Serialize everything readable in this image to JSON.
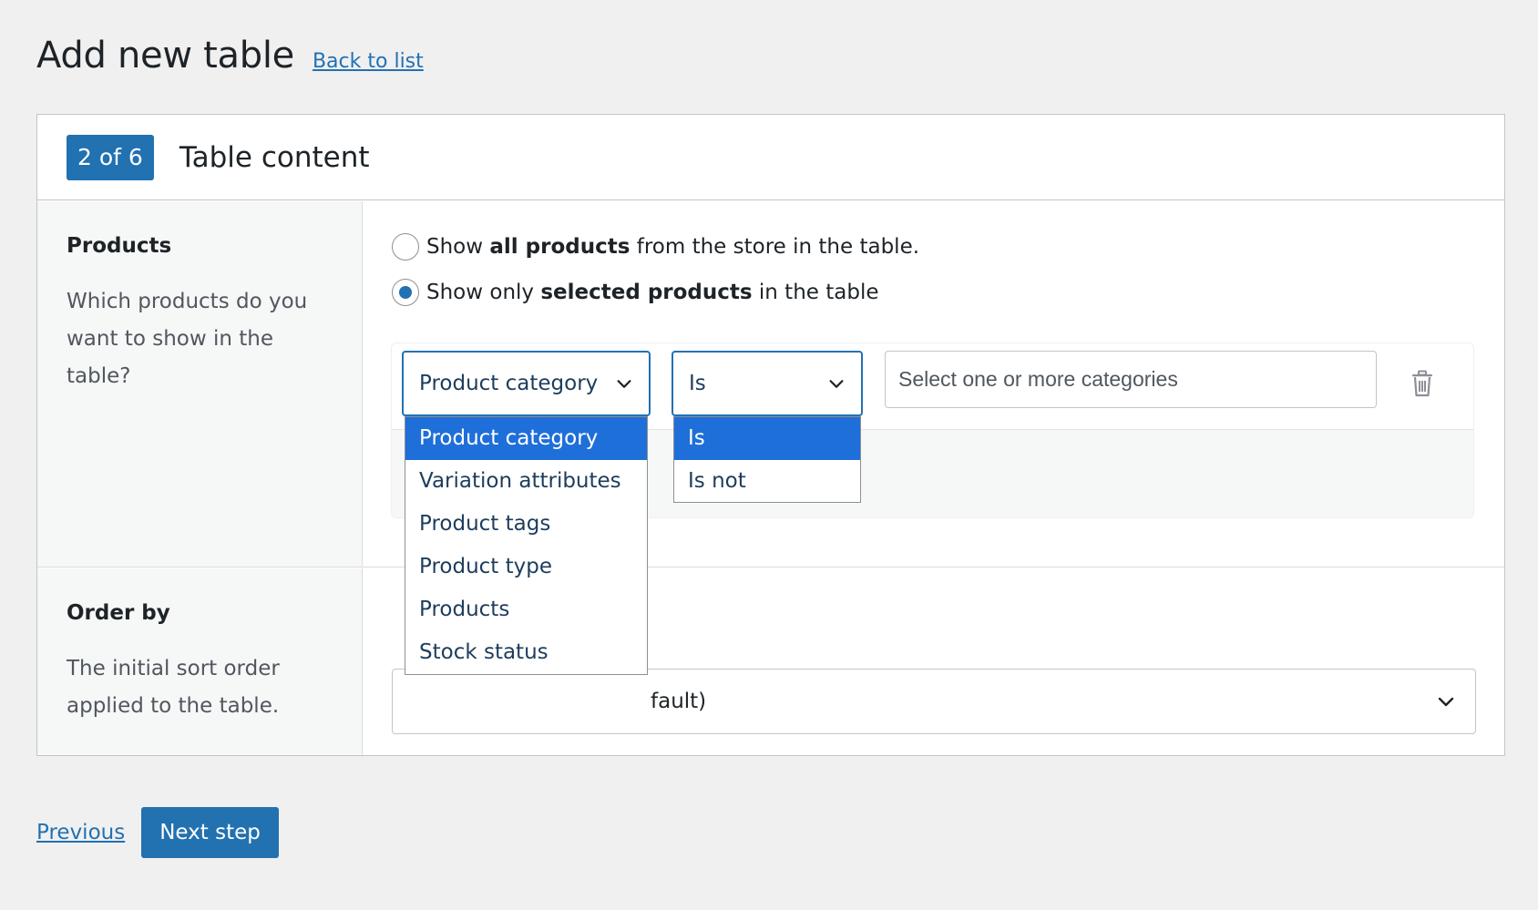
{
  "header": {
    "title": "Add new table",
    "back_link": "Back to list"
  },
  "panel": {
    "step_badge": "2 of 6",
    "title": "Table content"
  },
  "products_section": {
    "label": "Products",
    "description": "Which products do you want to show in the table?",
    "radio_all": {
      "prefix": "Show ",
      "bold": "all products",
      "suffix": " from the store in the table.",
      "checked": false
    },
    "radio_selected": {
      "prefix": "Show only ",
      "bold": "selected products",
      "suffix": " in the table",
      "checked": true
    },
    "condition": {
      "field_value": "Product category",
      "operator_value": "Is",
      "categories_placeholder": "Select one or more categories"
    }
  },
  "order_section": {
    "label": "Order by",
    "description": "The initial sort order applied to the table.",
    "select_value_visible": "fault)"
  },
  "field_dropdown": {
    "options": [
      "Product category",
      "Variation attributes",
      "Product tags",
      "Product type",
      "Products",
      "Stock status"
    ],
    "selected": "Product category"
  },
  "operator_dropdown": {
    "options": [
      "Is",
      "Is not"
    ],
    "selected": "Is"
  },
  "footer": {
    "previous_label": "Previous",
    "next_label": "Next step"
  },
  "colors": {
    "accent": "#2271b1",
    "highlight": "#1e6fd9",
    "background": "#f0f0f1"
  }
}
